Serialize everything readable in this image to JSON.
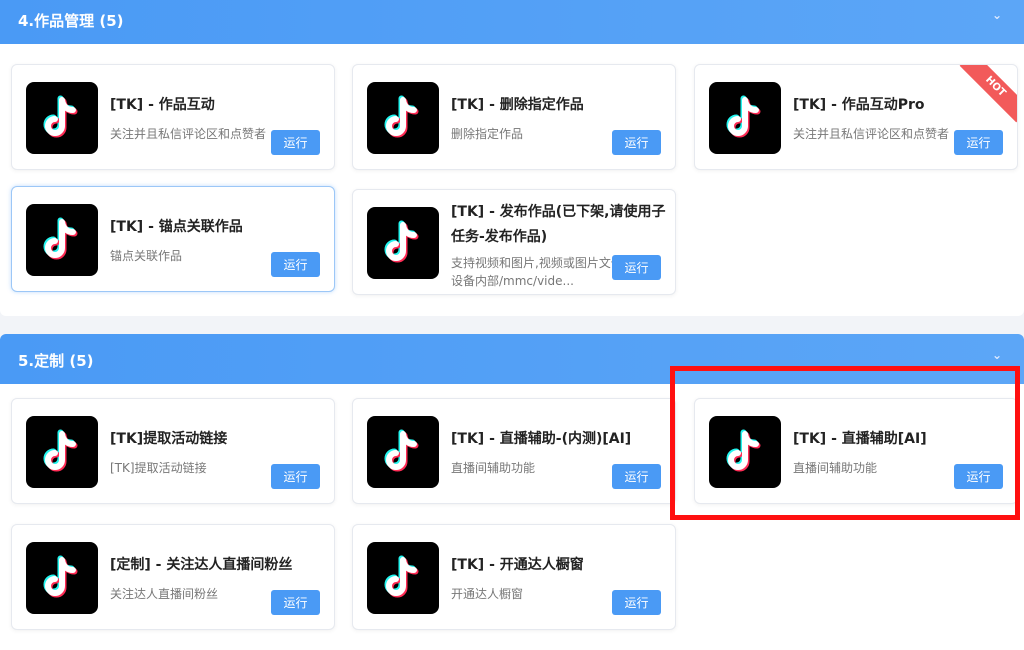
{
  "sections": [
    {
      "title": "4.作品管理 (5)",
      "cards": [
        {
          "title": "[TK] - 作品互动",
          "desc": "关注并且私信评论区和点赞者",
          "run": "运行"
        },
        {
          "title": "[TK] - 删除指定作品",
          "desc": "删除指定作品",
          "run": "运行"
        },
        {
          "title": "[TK] - 作品互动Pro",
          "desc": "关注并且私信评论区和点赞者",
          "run": "运行",
          "badge": "HOT"
        },
        {
          "title": "[TK] - 锚点关联作品",
          "desc": "锚点关联作品",
          "run": "运行"
        },
        {
          "title": "[TK] - 发布作品(已下架,请使用子任务-发布作品)",
          "desc": "支持视频和图片,视频或图片文件放到设备内部/mmc/vide...",
          "run": "运行"
        }
      ]
    },
    {
      "title": "5.定制 (5)",
      "cards": [
        {
          "title": "[TK]提取活动链接",
          "desc": "[TK]提取活动链接",
          "run": "运行"
        },
        {
          "title": "[TK] - 直播辅助-(内测)[AI]",
          "desc": "直播间辅助功能",
          "run": "运行"
        },
        {
          "title": "[TK] - 直播辅助[AI]",
          "desc": "直播间辅助功能",
          "run": "运行"
        },
        {
          "title": "[定制] - 关注达人直播间粉丝",
          "desc": "关注达人直播间粉丝",
          "run": "运行"
        },
        {
          "title": "[TK] - 开通达人橱窗",
          "desc": "开通达人橱窗",
          "run": "运行"
        }
      ]
    }
  ],
  "colors": {
    "accent": "#4a9af5",
    "highlight": "#ff1010",
    "hot": "#f25a5a"
  },
  "icons": {
    "thumb": "tiktok-logo-icon",
    "collapse": "chevron-down-icon"
  }
}
